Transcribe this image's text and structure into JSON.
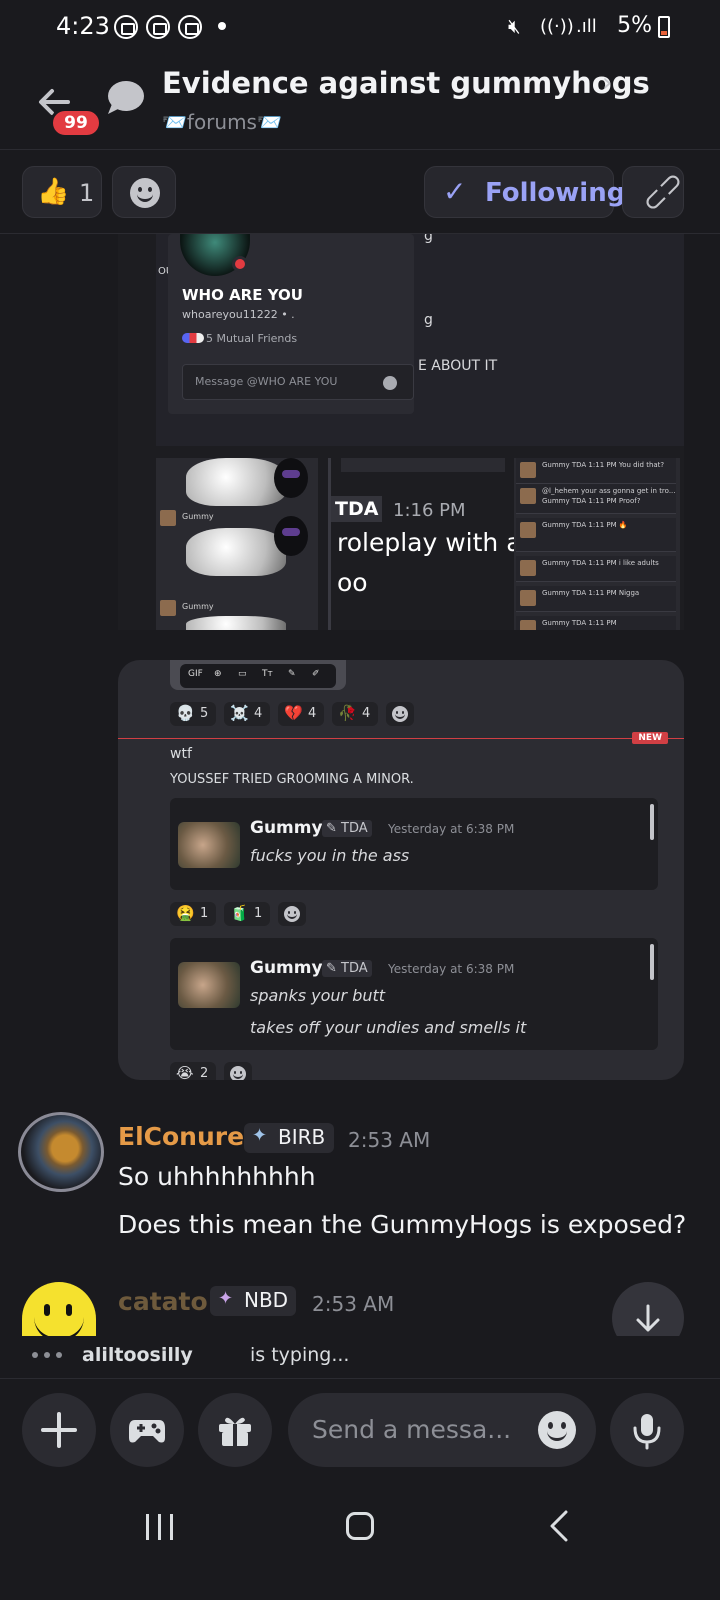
{
  "status_bar": {
    "time": "4:23",
    "battery": "5%"
  },
  "header": {
    "badge_count": "99",
    "title": "Evidence against gummyhogs",
    "channel": "📨forums📨"
  },
  "actions": {
    "thumb_emoji": "👍",
    "thumb_count": "1",
    "follow_label": "Following"
  },
  "screenshot": {
    "profile_name": "WHO ARE YOU",
    "profile_username": "whoareyou11222 • .",
    "mutual_friends": "5 Mutual Friends",
    "message_placeholder": "Message @WHO ARE YOU",
    "side_text_1": "g",
    "side_text_2": "g",
    "side_text_3": "E ABOUT IT",
    "side_text_4": "g",
    "left_fragment": "OU",
    "mini_name": "Gummy",
    "tda_tag": "TDA",
    "tda_time": "1:16 PM",
    "rp_line_1": "roleplay with a",
    "rp_line_2": "oo",
    "right_rows": [
      "Gummy TDA 1:11 PM\nYou did that?",
      "@l_hehem your ass gonna get in tro...\nGummy TDA 1:11 PM\nProof?",
      "Gummy TDA 1:11 PM\n🔥",
      "Gummy TDA 1:11 PM\ni like adults",
      "Gummy TDA 1:11 PM\nNigga",
      "Gummy TDA 1:11 PM"
    ]
  },
  "embed": {
    "toolbar": [
      "GIF",
      "⊕",
      "▭",
      "Tт",
      "✎",
      "✐"
    ],
    "reactions_top": [
      {
        "emoji": "💀",
        "count": "5"
      },
      {
        "emoji": "☠️",
        "count": "4"
      },
      {
        "emoji": "💔",
        "count": "4"
      },
      {
        "emoji": "🥀",
        "count": "4"
      }
    ],
    "new_label": "NEW",
    "line_wtf": "wtf",
    "line_youssef": "YOUSSEF TRIED GR0OMING A MINOR.",
    "quote1": {
      "name": "Gummy",
      "tag": "TDA",
      "time": "Yesterday at 6:38 PM",
      "text": "fucks you in the ass"
    },
    "reactions_mid": [
      {
        "emoji": "🤮",
        "count": "1"
      },
      {
        "emoji": "🧃",
        "count": "1"
      }
    ],
    "quote2": {
      "name": "Gummy",
      "tag": "TDA",
      "time": "Yesterday at 6:38 PM",
      "text1": "spanks your butt",
      "text2": "takes off your undies and smells it"
    },
    "reactions_bottom": [
      {
        "emoji": "😭",
        "count": "2"
      }
    ]
  },
  "messages": [
    {
      "author": "ElConure",
      "role": "BIRB",
      "time": "2:53 AM",
      "lines": [
        "So uhhhhhhhhh",
        "Does this mean the GummyHogs is exposed?"
      ]
    },
    {
      "author": "catato",
      "role": "NBD",
      "time": "2:53 AM"
    }
  ],
  "typing": {
    "user": "aliltoosilly",
    "rest": "is typing..."
  },
  "composer": {
    "placeholder": "Send a messa..."
  }
}
